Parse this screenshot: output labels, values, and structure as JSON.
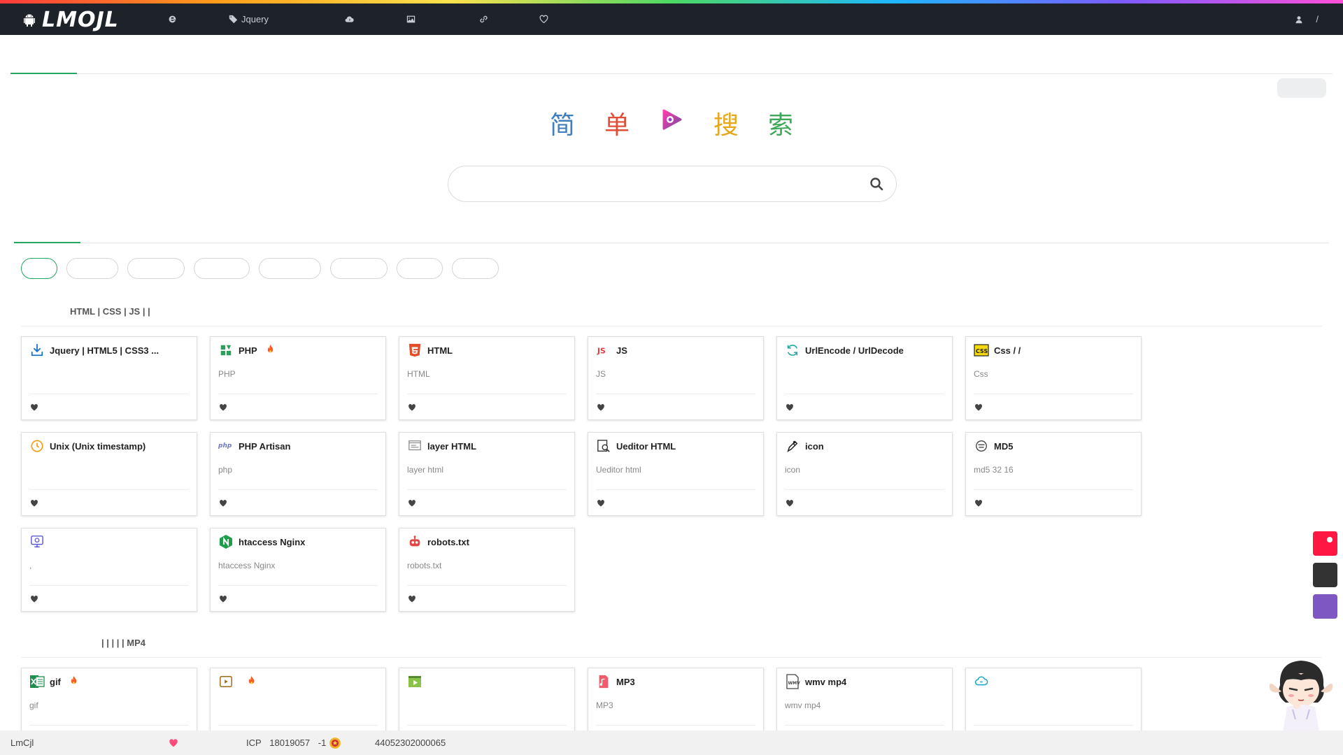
{
  "brand": {
    "logo_text": "LMOJL"
  },
  "nav": {
    "items": [
      {
        "icon": "ie-icon",
        "label": ""
      },
      {
        "icon": "tags-icon",
        "label": "Jquery"
      },
      {
        "icon": "cloud-download-icon",
        "label": ""
      },
      {
        "icon": "image-icon",
        "label": ""
      },
      {
        "icon": "link-icon",
        "label": ""
      },
      {
        "icon": "heart-icon",
        "label": ""
      }
    ],
    "user_separator": "/"
  },
  "hero": {
    "title_chars": [
      "简",
      "单",
      "搜",
      "索"
    ],
    "search_placeholder": ""
  },
  "sections": [
    {
      "title": "HTML | CSS | JS |       |",
      "cards": [
        {
          "icon": "download-icon",
          "title": "Jquery | HTML5 | CSS3          ...",
          "desc": "",
          "hot": false
        },
        {
          "icon": "php-grid-icon",
          "title": "PHP",
          "desc": "PHP",
          "hot": true
        },
        {
          "icon": "html5-icon",
          "title": "HTML",
          "desc": "HTML",
          "hot": false
        },
        {
          "icon": "js-icon",
          "title": "JS",
          "desc": "JS",
          "hot": false
        },
        {
          "icon": "refresh-icon",
          "title": "UrlEncode     / UrlDecode",
          "desc": "",
          "hot": false
        },
        {
          "icon": "css-icon",
          "title": "Css          /    /",
          "desc": "Css",
          "hot": false
        },
        {
          "icon": "clock-icon",
          "title": "Unix      (Unix timestamp)",
          "desc": "",
          "hot": false
        },
        {
          "icon": "php-text-icon",
          "title": "PHP Artisan",
          "desc": "php",
          "hot": false
        },
        {
          "icon": "layer-icon",
          "title": "layer          HTML",
          "desc": "layer   html",
          "hot": false
        },
        {
          "icon": "ueditor-icon",
          "title": "Ueditor          HTML",
          "desc": "Ueditor   html",
          "hot": false
        },
        {
          "icon": "pen-icon",
          "title": "icon",
          "desc": "icon",
          "hot": false
        },
        {
          "icon": "md5-icon",
          "title": "MD5",
          "desc": "md5    32    16",
          "hot": false
        },
        {
          "icon": "monitor-icon",
          "title": "",
          "desc": ",",
          "hot": false
        },
        {
          "icon": "nginx-icon",
          "title": "htaccess  Nginx",
          "desc": "htaccess   Nginx",
          "hot": false
        },
        {
          "icon": "robot-icon",
          "title": "robots.txt",
          "desc": "robots.txt",
          "hot": false
        }
      ]
    },
    {
      "title": "|        |        |        |        | MP4",
      "cards": [
        {
          "icon": "excel-icon",
          "title": "gif",
          "desc": "gif",
          "hot": true
        },
        {
          "icon": "video-frame-icon",
          "title": "",
          "desc": "",
          "hot": true
        },
        {
          "icon": "clapper-icon",
          "title": "",
          "desc": "",
          "hot": false
        },
        {
          "icon": "music-file-icon",
          "title": "MP3",
          "desc": "MP3",
          "hot": false
        },
        {
          "icon": "wmv-icon",
          "title": "wmv      mp4",
          "desc": "wmv            mp4",
          "hot": false
        },
        {
          "icon": "cloud-link-icon",
          "title": "",
          "desc": "",
          "hot": false
        }
      ]
    }
  ],
  "footer": {
    "site": "LmCjl",
    "icp_label": "ICP",
    "icp_number": "18019057",
    "icp_suffix": "-1",
    "police_number": "44052302000065"
  },
  "colors": {
    "topbar": "#1e2329",
    "accent": "#25a55f",
    "side_red": "#ff1744",
    "side_dark": "#333333",
    "side_purple": "#7e57c2"
  }
}
